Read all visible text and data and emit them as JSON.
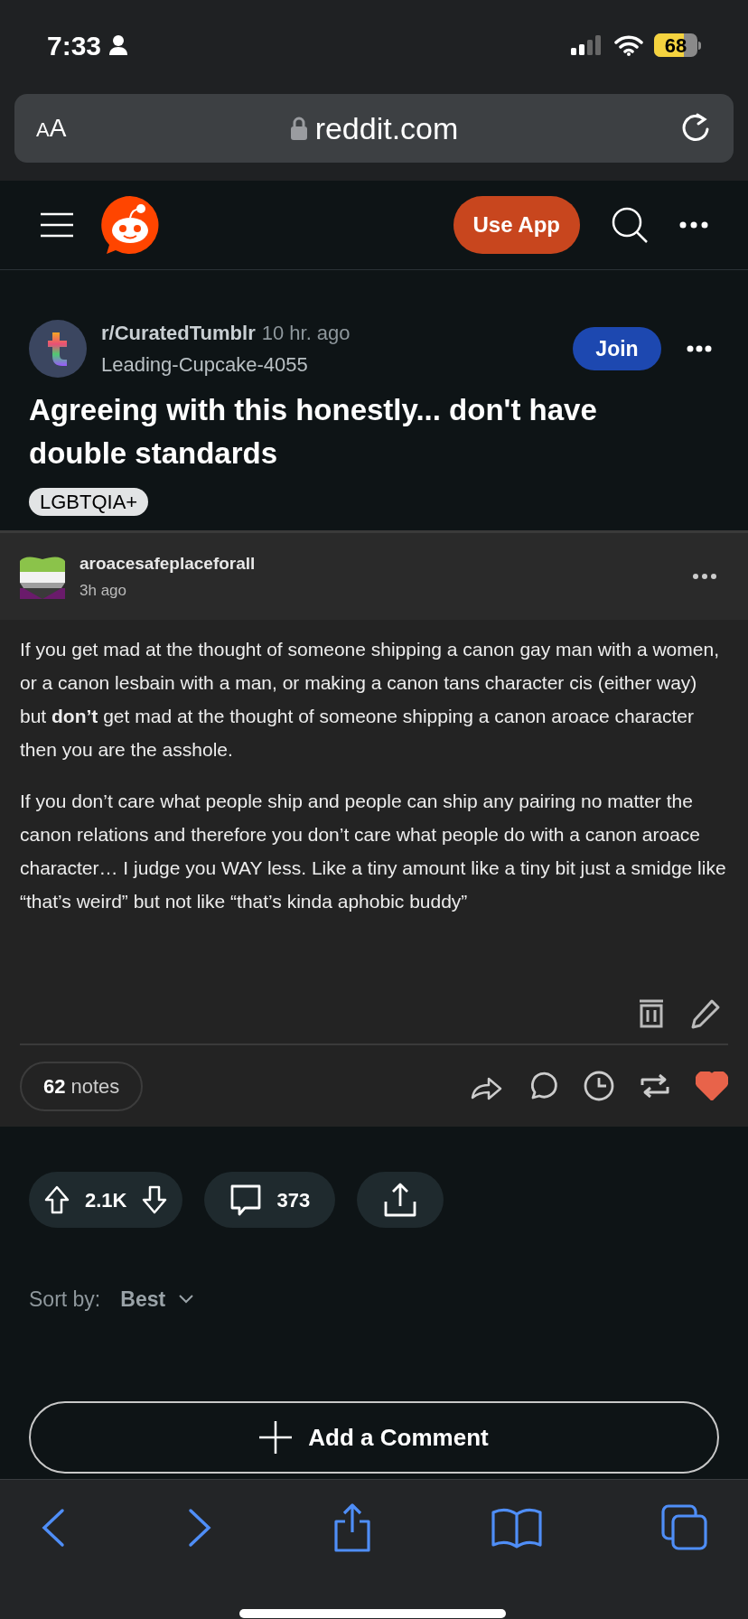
{
  "status_bar": {
    "time": "7:33",
    "battery": "68"
  },
  "browser": {
    "text_size": "AA",
    "url": "reddit.com"
  },
  "reddit_header": {
    "use_app": "Use App"
  },
  "post": {
    "subreddit": "r/CuratedTumblr",
    "age": "10 hr. ago",
    "author": "Leading-Cupcake-4055",
    "join": "Join",
    "title": "Agreeing with this honestly... don't have double standards",
    "flair": "LGBTQIA+"
  },
  "tumblr": {
    "username": "aroacesafeplaceforall",
    "age": "3h ago",
    "paragraphs": [
      "If you get mad at the thought of someone shipping a canon gay man with a women, or a canon lesbain with a man, or making a canon tans character cis (either way) but **don’t** get mad at the thought of someone shipping a canon aroace character then you are the asshole.",
      "If you don’t care what people ship and people can ship any pairing no matter the canon relations and therefore you don’t care what people do with a canon aroace character… I judge you WAY less. Like a tiny amount like a tiny bit just a smidge like “that’s weird” but not like “that’s kinda aphobic buddy”"
    ],
    "notes_count": "62",
    "notes_label": "notes",
    "liked": true
  },
  "actions": {
    "score": "2.1K",
    "comments": "373"
  },
  "sort": {
    "label": "Sort by:",
    "value": "Best"
  },
  "add_comment": "Add a Comment"
}
